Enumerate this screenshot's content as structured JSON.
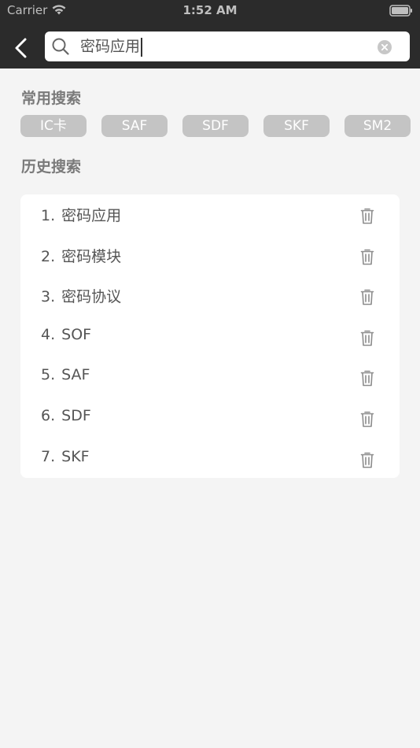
{
  "status_bar": {
    "carrier": "Carrier",
    "time": "1:52 AM",
    "wifi_icon": "wifi-icon",
    "battery_icon": "battery-icon"
  },
  "nav": {
    "back_icon": "chevron-left-icon",
    "search": {
      "value": "密码应用",
      "icon": "search-icon",
      "clear_icon": "clear-icon"
    }
  },
  "common_search": {
    "title": "常用搜索",
    "tags": [
      "IC卡",
      "SAF",
      "SDF",
      "SKF",
      "SM2"
    ]
  },
  "history_search": {
    "title": "历史搜索",
    "items": [
      {
        "index": "1.",
        "label": "密码应用"
      },
      {
        "index": "2.",
        "label": "密码模块"
      },
      {
        "index": "3.",
        "label": "密码协议"
      },
      {
        "index": "4.",
        "label": "SOF"
      },
      {
        "index": "5.",
        "label": "SAF"
      },
      {
        "index": "6.",
        "label": "SDF"
      },
      {
        "index": "7.",
        "label": "SKF"
      }
    ],
    "delete_icon": "trash-icon"
  },
  "colors": {
    "header_bg": "#2b2b2b",
    "page_bg": "#f4f4f4",
    "tag_bg": "#c4c4c4",
    "tag_text": "#ffffff",
    "section_title": "#7a7a7a",
    "list_text": "#555555"
  }
}
